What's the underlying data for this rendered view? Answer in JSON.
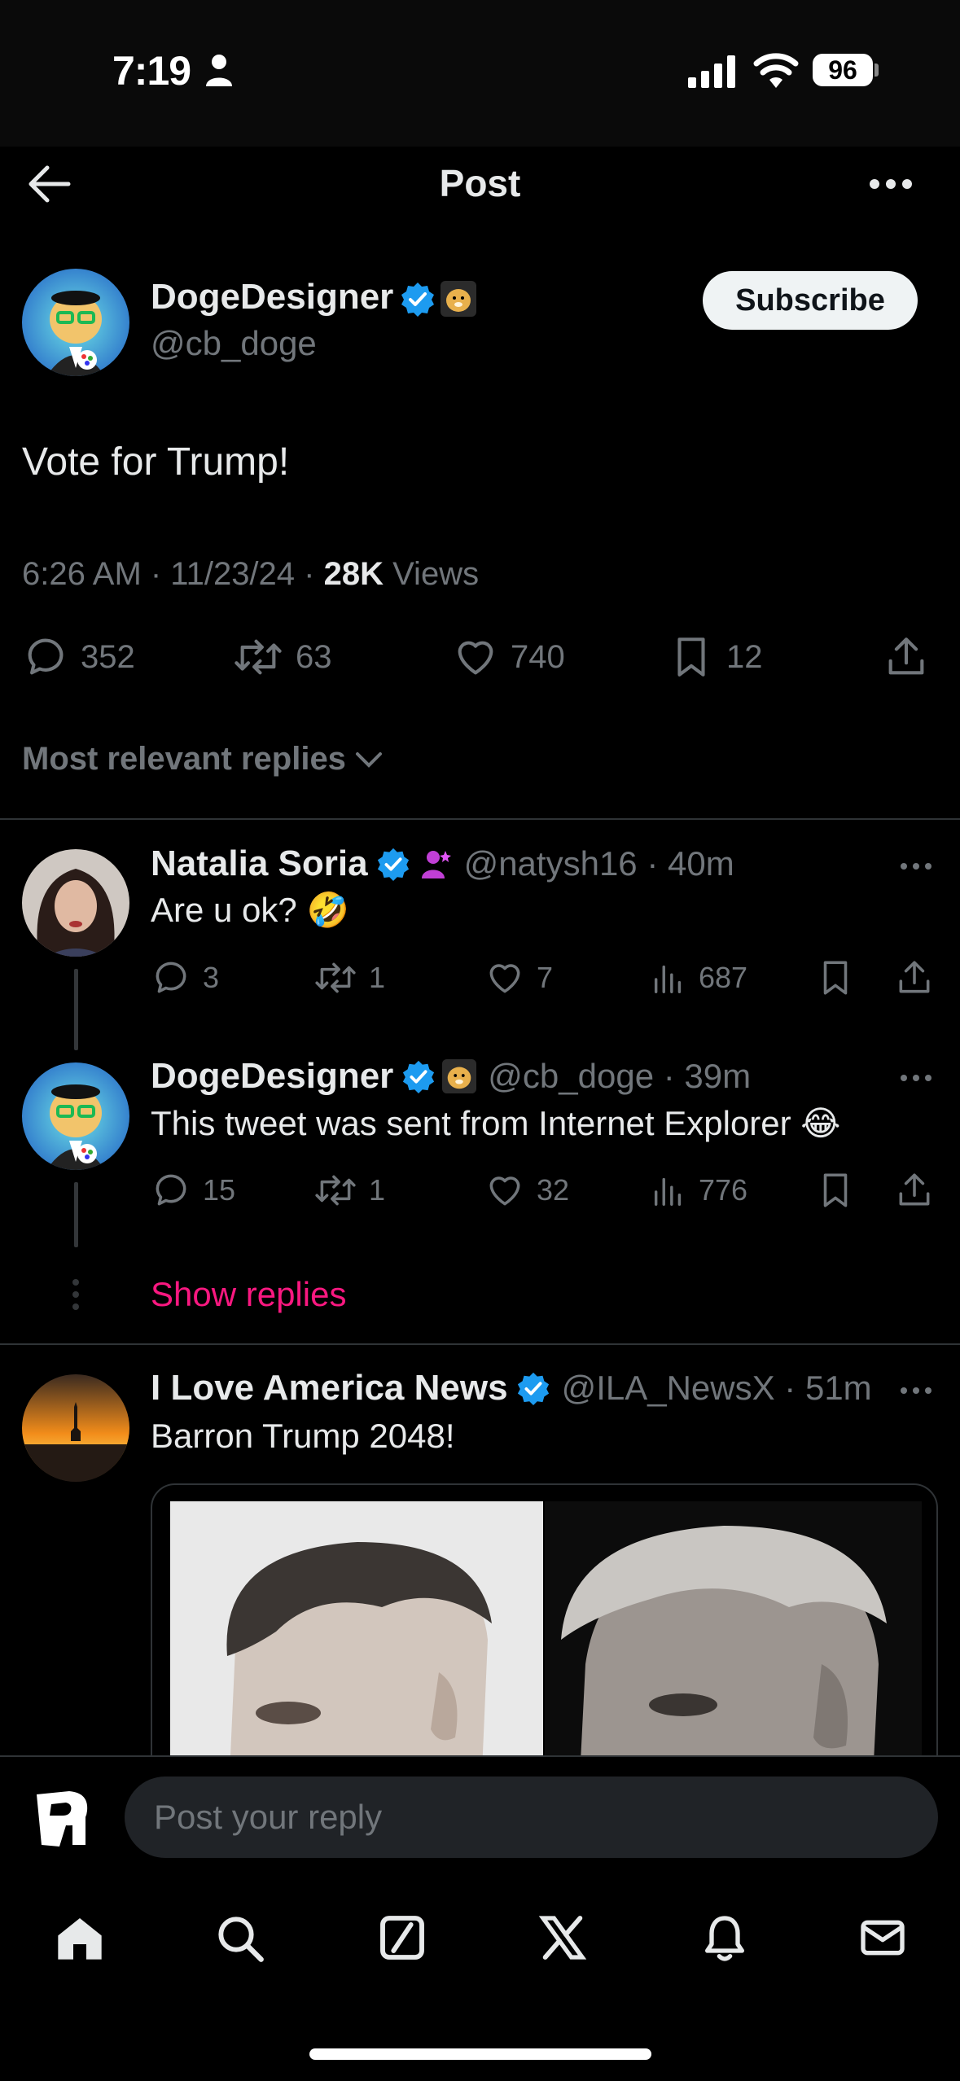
{
  "status_bar": {
    "time": "7:19",
    "battery": "96"
  },
  "header": {
    "title": "Post"
  },
  "post": {
    "author_name": "DogeDesigner",
    "handle": "@cb_doge",
    "subscribe_label": "Subscribe",
    "text": "Vote for Trump!",
    "timestamp": "6:26 AM · 11/23/24 · ",
    "views_count": "28K",
    "views_label": " Views",
    "replies": "352",
    "reposts": "63",
    "likes": "740",
    "bookmarks": "12"
  },
  "sort": {
    "label": "Most relevant replies"
  },
  "replies": [
    {
      "name": "Natalia Soria",
      "meta": "@natysh16 · 40m",
      "text": "Are u ok? 🤣",
      "replies": "3",
      "reposts": "1",
      "likes": "7",
      "views": "687"
    },
    {
      "name": "DogeDesigner",
      "meta": "@cb_doge · 39m",
      "text": "This tweet was sent from Internet Explorer 😂",
      "replies": "15",
      "reposts": "1",
      "likes": "32",
      "views": "776"
    },
    {
      "name": "I Love America News",
      "meta": "@ILA_NewsX · 51m",
      "text": "Barron Trump 2048!"
    }
  ],
  "show_replies": "Show replies",
  "compose": {
    "placeholder": "Post your reply"
  },
  "colors": {
    "accent_pink": "#f91880",
    "verified_blue": "#1d9bf0",
    "background": "#000000"
  },
  "icons": {
    "back": "arrow-left-icon",
    "more": "more-icon",
    "reply": "reply-icon",
    "repost": "repost-icon",
    "like": "heart-icon",
    "bookmark": "bookmark-icon",
    "share": "share-icon",
    "views": "views-icon",
    "tabs": [
      "home-icon",
      "search-icon",
      "grok-icon",
      "x-logo-icon",
      "bell-icon",
      "mail-icon"
    ]
  }
}
